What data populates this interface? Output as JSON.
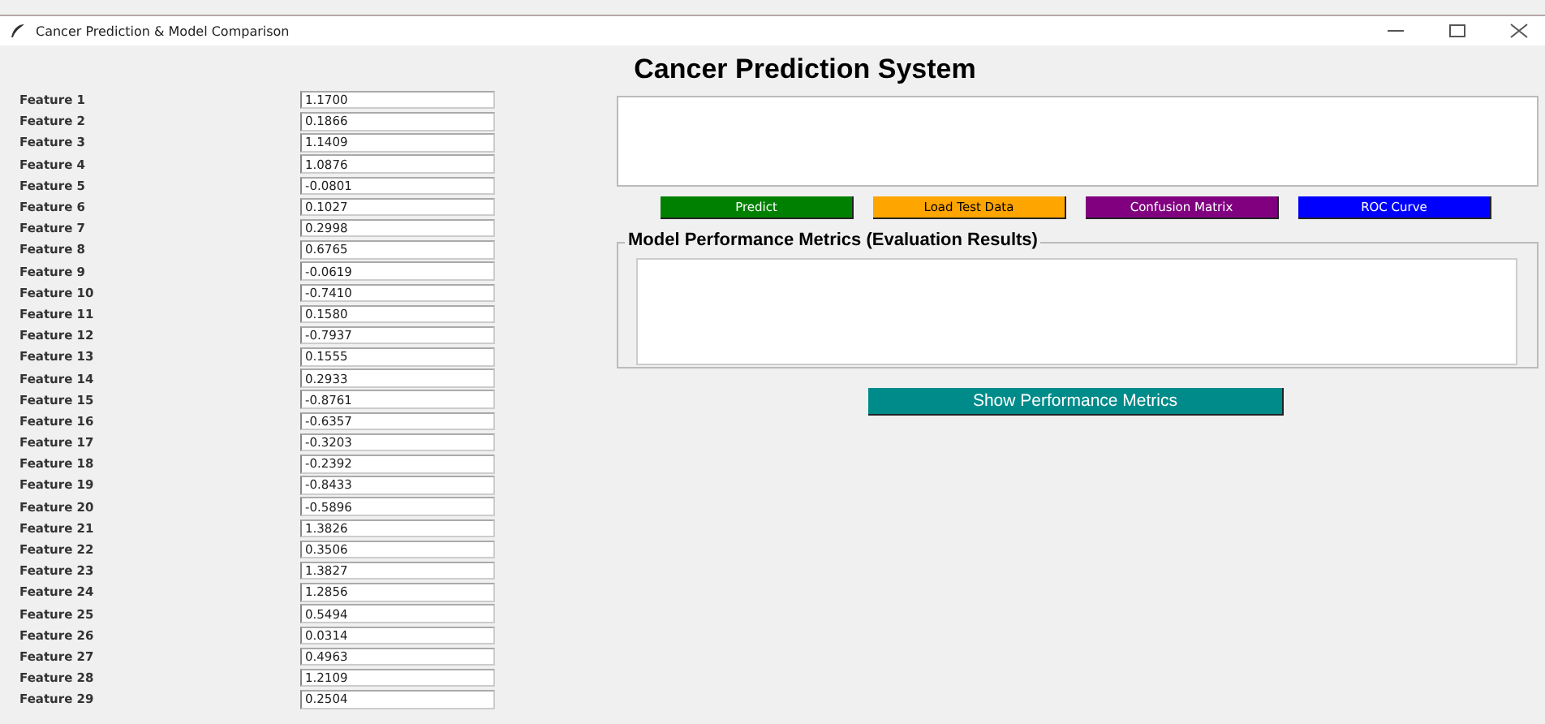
{
  "window": {
    "title": "Cancer Prediction & Model Comparison"
  },
  "heading": "Cancer Prediction System",
  "features": [
    {
      "label": "Feature 1",
      "value": "1.1700"
    },
    {
      "label": "Feature 2",
      "value": "0.1866"
    },
    {
      "label": "Feature 3",
      "value": "1.1409"
    },
    {
      "label": "Feature 4",
      "value": "1.0876"
    },
    {
      "label": "Feature 5",
      "value": "-0.0801"
    },
    {
      "label": "Feature 6",
      "value": "0.1027"
    },
    {
      "label": "Feature 7",
      "value": "0.2998"
    },
    {
      "label": "Feature 8",
      "value": "0.6765"
    },
    {
      "label": "Feature 9",
      "value": "-0.0619"
    },
    {
      "label": "Feature 10",
      "value": "-0.7410"
    },
    {
      "label": "Feature 11",
      "value": "0.1580"
    },
    {
      "label": "Feature 12",
      "value": "-0.7937"
    },
    {
      "label": "Feature 13",
      "value": "0.1555"
    },
    {
      "label": "Feature 14",
      "value": "0.2933"
    },
    {
      "label": "Feature 15",
      "value": "-0.8761"
    },
    {
      "label": "Feature 16",
      "value": "-0.6357"
    },
    {
      "label": "Feature 17",
      "value": "-0.3203"
    },
    {
      "label": "Feature 18",
      "value": "-0.2392"
    },
    {
      "label": "Feature 19",
      "value": "-0.8433"
    },
    {
      "label": "Feature 20",
      "value": "-0.5896"
    },
    {
      "label": "Feature 21",
      "value": "1.3826"
    },
    {
      "label": "Feature 22",
      "value": "0.3506"
    },
    {
      "label": "Feature 23",
      "value": "1.3827"
    },
    {
      "label": "Feature 24",
      "value": "1.2856"
    },
    {
      "label": "Feature 25",
      "value": "0.5494"
    },
    {
      "label": "Feature 26",
      "value": "0.0314"
    },
    {
      "label": "Feature 27",
      "value": "0.4963"
    },
    {
      "label": "Feature 28",
      "value": "1.2109"
    },
    {
      "label": "Feature 29",
      "value": "0.2504"
    }
  ],
  "actions": [
    {
      "label": "Predict",
      "color": "#008000"
    },
    {
      "label": "Load Test Data",
      "color": "#ffa500"
    },
    {
      "label": "Confusion Matrix",
      "color": "#800080"
    },
    {
      "label": "ROC Curve",
      "color": "#0000ff"
    }
  ],
  "metrics": {
    "title": "Model Performance Metrics (Evaluation Results)"
  },
  "show_metrics_button": {
    "label": "Show Performance Metrics",
    "color": "#008b8b"
  }
}
